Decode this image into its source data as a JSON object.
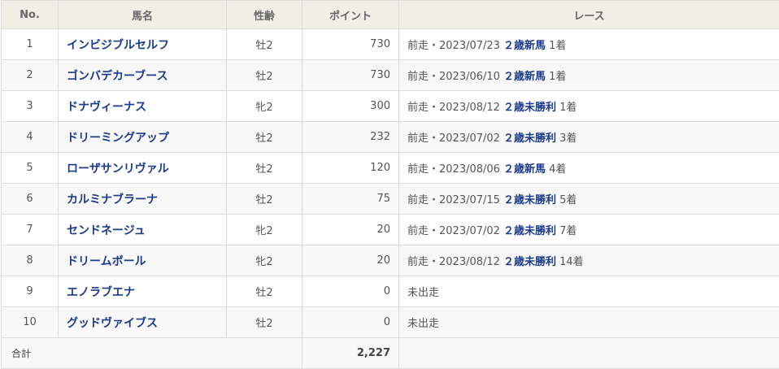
{
  "table": {
    "headers": {
      "no": "No.",
      "name": "馬名",
      "sex_age": "性齢",
      "point": "ポイント",
      "race": "レース"
    },
    "rows": [
      {
        "no": "1",
        "name": "インビジブルセルフ",
        "sex_age": "牡2",
        "point": "730",
        "race_prefix": "前走・2023/07/23",
        "race_name": "２歳新馬",
        "finish": "1着"
      },
      {
        "no": "2",
        "name": "ゴンバデカーブース",
        "sex_age": "牡2",
        "point": "730",
        "race_prefix": "前走・2023/06/10",
        "race_name": "２歳新馬",
        "finish": "1着"
      },
      {
        "no": "3",
        "name": "ドナヴィーナス",
        "sex_age": "牝2",
        "point": "300",
        "race_prefix": "前走・2023/08/12",
        "race_name": "２歳未勝利",
        "finish": "1着"
      },
      {
        "no": "4",
        "name": "ドリーミングアップ",
        "sex_age": "牡2",
        "point": "232",
        "race_prefix": "前走・2023/07/02",
        "race_name": "２歳未勝利",
        "finish": "3着"
      },
      {
        "no": "5",
        "name": "ローザサンリヴァル",
        "sex_age": "牡2",
        "point": "120",
        "race_prefix": "前走・2023/08/06",
        "race_name": "２歳新馬",
        "finish": "4着"
      },
      {
        "no": "6",
        "name": "カルミナブラーナ",
        "sex_age": "牡2",
        "point": "75",
        "race_prefix": "前走・2023/07/15",
        "race_name": "２歳未勝利",
        "finish": "5着"
      },
      {
        "no": "7",
        "name": "センドネージュ",
        "sex_age": "牝2",
        "point": "20",
        "race_prefix": "前走・2023/07/02",
        "race_name": "２歳未勝利",
        "finish": "7着"
      },
      {
        "no": "8",
        "name": "ドリームボール",
        "sex_age": "牝2",
        "point": "20",
        "race_prefix": "前走・2023/08/12",
        "race_name": "２歳未勝利",
        "finish": "14着"
      },
      {
        "no": "9",
        "name": "エノラブエナ",
        "sex_age": "牡2",
        "point": "0",
        "race_prefix": "未出走",
        "race_name": "",
        "finish": ""
      },
      {
        "no": "10",
        "name": "グッドヴァイブス",
        "sex_age": "牡2",
        "point": "0",
        "race_prefix": "未出走",
        "race_name": "",
        "finish": ""
      }
    ],
    "footer": {
      "label": "合計",
      "total": "2,227"
    }
  },
  "colors": {
    "header_bg": "#f1eee5",
    "link": "#1a3a8c",
    "alt_row_bg": "#f8f8f8",
    "border": "#dcdcdc"
  }
}
